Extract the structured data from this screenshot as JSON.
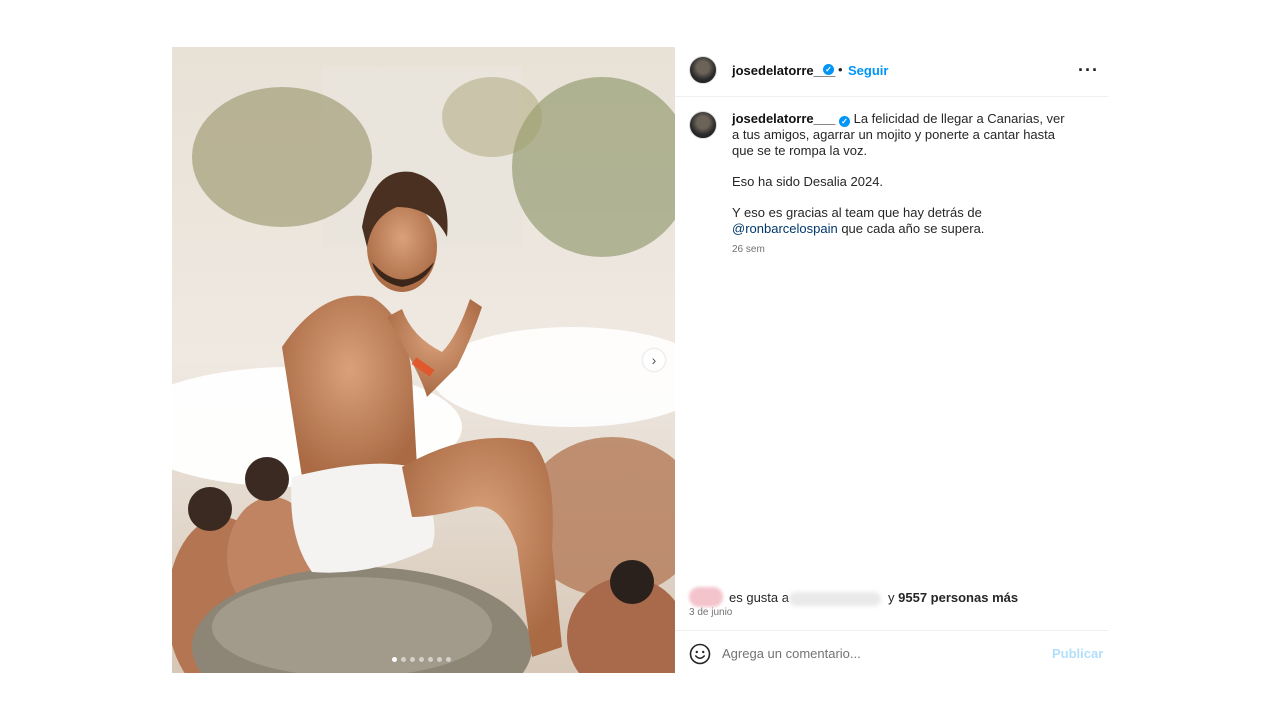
{
  "post": {
    "image_alt": "",
    "carousel_total": 7,
    "carousel_active": 1
  },
  "header": {
    "username": "josedelatorre___",
    "separator": "•",
    "follow_label": "Seguir",
    "more_icon": "more-horizontal-icon"
  },
  "caption": {
    "username": "josedelatorre___",
    "text_1": "La felicidad de llegar a Canarias, ver a tus amigos, agarrar un mojito y ponerte a cantar hasta que se te rompa la voz.",
    "text_2": "Eso ha sido Desalia 2024.",
    "text_3_pre": "Y eso es gracias al team que hay detrás de ",
    "mention": "@ronbarcelospain",
    "text_3_post": " que cada año se supera.",
    "time_ago": "26 sem"
  },
  "likes": {
    "prefix": "es gusta a",
    "suffix_pre": "y ",
    "count_label": "9557 personas más"
  },
  "post_date": "3 de junio",
  "comment": {
    "placeholder": "Agrega un comentario...",
    "publish_label": "Publicar",
    "emoji_icon": "emoji-smile-icon"
  },
  "colors": {
    "accent": "#0095f6",
    "mention": "#00376b",
    "publish_disabled": "#b2dffc"
  }
}
